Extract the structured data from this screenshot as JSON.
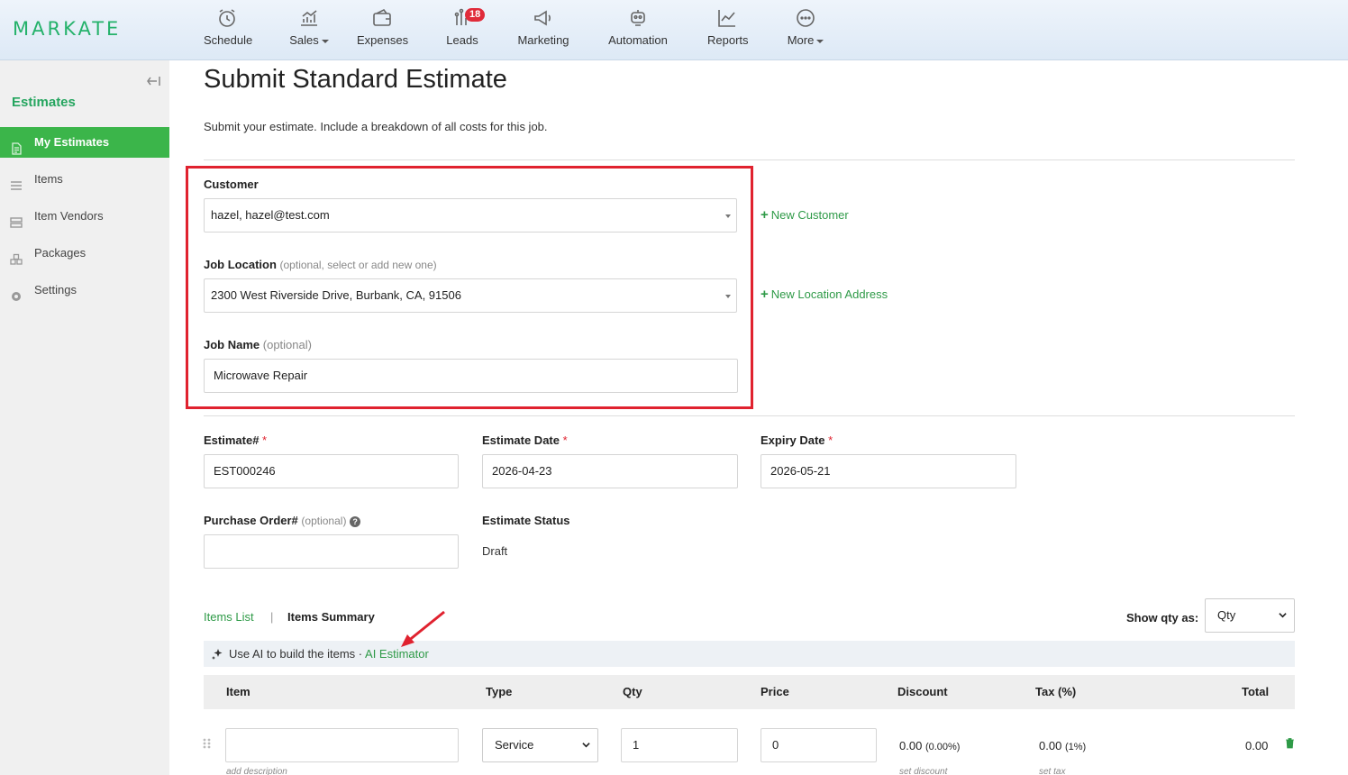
{
  "brand": {
    "logo": "MARKATE",
    "accent": "#25b26b"
  },
  "nav": [
    {
      "label": "Schedule",
      "icon": "alarm-clock-icon"
    },
    {
      "label": "Sales",
      "icon": "sales-chart-icon",
      "dropdown": true
    },
    {
      "label": "Expenses",
      "icon": "wallet-icon"
    },
    {
      "label": "Leads",
      "icon": "leads-bars-icon",
      "badge": "18"
    },
    {
      "label": "Marketing",
      "icon": "megaphone-icon"
    },
    {
      "label": "Automation",
      "icon": "robot-icon"
    },
    {
      "label": "Reports",
      "icon": "line-chart-icon"
    },
    {
      "label": "More",
      "icon": "more-dots-icon",
      "dropdown": true
    }
  ],
  "sidebar": {
    "title": "Estimates",
    "items": [
      {
        "label": "My Estimates",
        "icon": "document-icon",
        "active": true
      },
      {
        "label": "Items",
        "icon": "list-icon"
      },
      {
        "label": "Item Vendors",
        "icon": "vendor-icon"
      },
      {
        "label": "Packages",
        "icon": "packages-icon"
      },
      {
        "label": "Settings",
        "icon": "gear-icon"
      }
    ]
  },
  "page": {
    "title": "Submit Standard Estimate",
    "subtitle": "Submit your estimate. Include a breakdown of all costs for this job."
  },
  "form": {
    "customer": {
      "label": "Customer",
      "value": "hazel, hazel@test.com",
      "new_link": "New Customer"
    },
    "job_location": {
      "label": "Job Location",
      "hint": "(optional, select or add new one)",
      "value": "2300 West Riverside Drive, Burbank, CA, 91506",
      "new_link": "New Location Address"
    },
    "job_name": {
      "label": "Job Name",
      "hint": "(optional)",
      "value": "Microwave Repair"
    },
    "estimate_no": {
      "label": "Estimate#",
      "value": "EST000246"
    },
    "estimate_date": {
      "label": "Estimate Date",
      "value": "2026-04-23"
    },
    "expiry_date": {
      "label": "Expiry Date",
      "value": "2026-05-21"
    },
    "purchase_order": {
      "label": "Purchase Order#",
      "hint": "(optional)",
      "value": ""
    },
    "estimate_status": {
      "label": "Estimate Status",
      "value": "Draft"
    },
    "required_mark": "*",
    "help_mark": "?"
  },
  "items": {
    "tab_list": "Items List",
    "tab_separator": "|",
    "tab_summary": "Items Summary",
    "show_qty_label": "Show qty as:",
    "show_qty_value": "Qty",
    "ai_text": "Use AI to build the items · ",
    "ai_link": "AI Estimator",
    "columns": [
      "Item",
      "Type",
      "Qty",
      "Price",
      "Discount",
      "Tax (%)",
      "Total"
    ],
    "row": {
      "item": "",
      "item_hint": "add description",
      "type": "Service",
      "qty": "1",
      "price": "0",
      "discount": "0.00",
      "discount_pct": "(0.00%)",
      "discount_hint": "set discount",
      "tax": "0.00",
      "tax_pct": "(1%)",
      "tax_hint": "set tax",
      "total": "0.00"
    }
  },
  "colors": {
    "highlight_box": "#e0222f",
    "active_sidebar": "#3bb54a",
    "link_green": "#2e9a47"
  }
}
